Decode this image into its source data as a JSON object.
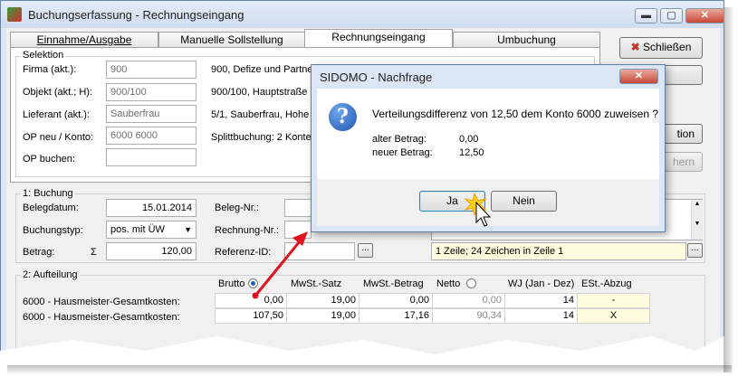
{
  "window": {
    "title": "Buchungserfassung - Rechnungseingang",
    "close_symbol": "✕",
    "min_symbol": "▬",
    "max_symbol": "▢"
  },
  "tabs": [
    {
      "label": "Einnahme/Ausgabe"
    },
    {
      "label": "Manuelle Sollstellung"
    },
    {
      "label": "Rechnungseingang"
    },
    {
      "label": "Umbuchung"
    }
  ],
  "side": {
    "close_label": "Schließen",
    "btn3_label": "tion",
    "btn4_label": "hern"
  },
  "selektion": {
    "legend": "Selektion",
    "rows": [
      {
        "label": "Firma (akt.):",
        "value": "900",
        "desc": "900,  Defize und Partne"
      },
      {
        "label": "Objekt (akt.; H):",
        "value": "900/100",
        "desc": "900/100,  Hauptstraße"
      },
      {
        "label": "Lieferant (akt.):",
        "value": "Sauberfrau",
        "desc": "5/1,  Sauberfrau,  Hohe"
      },
      {
        "label": "OP neu / Konto:",
        "value": "6000 6000",
        "desc": "Splittbuchung:  2 Konte"
      },
      {
        "label": "OP buchen:",
        "value": "",
        "desc": ""
      }
    ]
  },
  "buchung": {
    "legend": "1: Buchung",
    "belegdatum_label": "Belegdatum:",
    "belegdatum": "15.01.2014",
    "buchungstyp_label": "Buchungstyp:",
    "buchungstyp": "pos. mit ÜW",
    "betrag_label": "Betrag:",
    "sigma": "Σ",
    "betrag": "120,00",
    "belegnr_label": "Beleg-Nr.:",
    "rechnungnr_label": "Rechnung-Nr.:",
    "referenz_label": "Referenz-ID:",
    "dots": "...",
    "info": "1 Zeile; 24 Zeichen in Zeile 1"
  },
  "aufteilung": {
    "legend": "2: Aufteilung",
    "headers": [
      "Brutto",
      "MwSt.-Satz",
      "MwSt.-Betrag",
      "Netto",
      "WJ (Jan - Dez)",
      "ESt.-Abzug"
    ],
    "rows": [
      {
        "konto": "6000 - Hausmeister-Gesamtkosten:",
        "brutto": "0,00",
        "satz": "19,00",
        "betrag": "0,00",
        "netto": "0,00",
        "wj": "14",
        "est": "-"
      },
      {
        "konto": "6000 - Hausmeister-Gesamtkosten:",
        "brutto": "107,50",
        "satz": "19,00",
        "betrag": "17,16",
        "netto": "90,34",
        "wj": "14",
        "est": "X"
      }
    ]
  },
  "dialog": {
    "title": "SIDOMO - Nachfrage",
    "close_symbol": "✕",
    "question_symbol": "?",
    "message": "Verteilungsdifferenz von 12,50 dem Konto 6000 zuweisen ?",
    "alter_label": "alter Betrag:",
    "alter_value": "0,00",
    "neuer_label": "neuer Betrag:",
    "neuer_value": "12,50",
    "yes_label": "Ja",
    "no_label": "Nein"
  }
}
